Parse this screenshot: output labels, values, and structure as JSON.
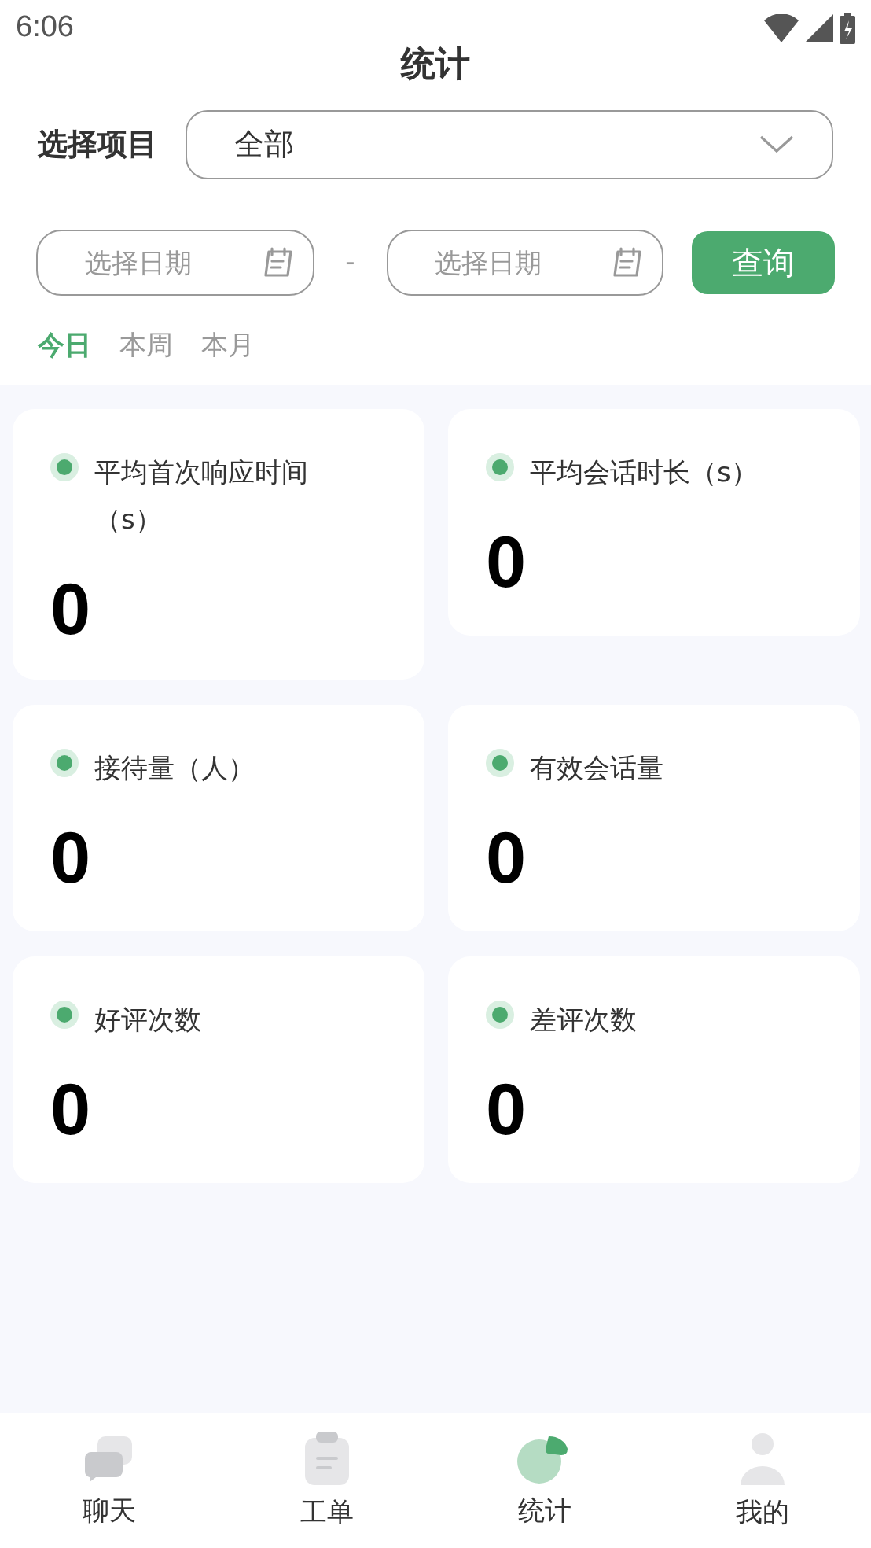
{
  "status_bar": {
    "time": "6:06"
  },
  "title": "统计",
  "project": {
    "label": "选择项目",
    "value": "全部"
  },
  "dates": {
    "start_placeholder": "选择日期",
    "separator": "-",
    "end_placeholder": "选择日期",
    "query_button": "查询"
  },
  "periods": [
    {
      "label": "今日",
      "selected": true
    },
    {
      "label": "本周",
      "selected": false
    },
    {
      "label": "本月",
      "selected": false
    }
  ],
  "stats": [
    {
      "label": "平均首次响应时间（s）",
      "value": "0"
    },
    {
      "label": "平均会话时长（s）",
      "value": "0"
    },
    {
      "label": "接待量（人）",
      "value": "0"
    },
    {
      "label": "有效会话量",
      "value": "0"
    },
    {
      "label": "好评次数",
      "value": "0"
    },
    {
      "label": "差评次数",
      "value": "0"
    }
  ],
  "tab_bar": [
    {
      "label": "聊天",
      "kind": "chat",
      "selected": false
    },
    {
      "label": "工单",
      "kind": "ticket",
      "selected": false
    },
    {
      "label": "统计",
      "kind": "stats",
      "selected": true
    },
    {
      "label": "我的",
      "kind": "profile",
      "selected": false
    }
  ]
}
